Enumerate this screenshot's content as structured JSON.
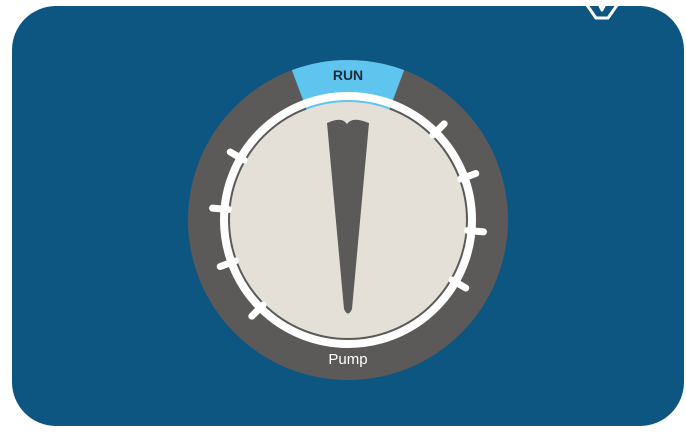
{
  "dial": {
    "name": "Pump",
    "mode_label": "RUN",
    "selected_mode": "RUN",
    "tick_count": 8
  },
  "colors": {
    "background_panel": "#0e5682",
    "bezel": "#5b5a58",
    "face": "#e4e0d7",
    "ring": "#ffffff",
    "active_segment": "#5fc5ef",
    "pointer": "#5b5a58"
  },
  "icons": {
    "corner": "brand-logo-icon"
  }
}
